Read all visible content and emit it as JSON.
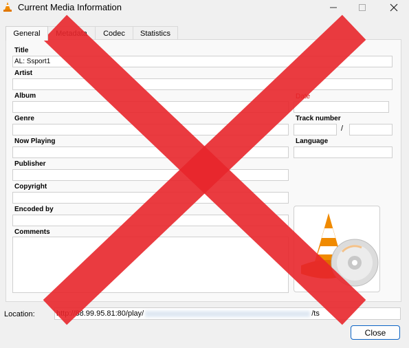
{
  "window": {
    "title": "Current Media Information",
    "icons": {
      "app": "vlc-cone-icon",
      "minimize": "minimize-icon",
      "maximize": "maximize-icon",
      "close": "close-icon"
    }
  },
  "tabs": [
    {
      "label": "General",
      "active": true
    },
    {
      "label": "Metadata",
      "active": false
    },
    {
      "label": "Codec",
      "active": false
    },
    {
      "label": "Statistics",
      "active": false
    }
  ],
  "general": {
    "title_label": "Title",
    "title_value": "AL: Ssport1",
    "artist_label": "Artist",
    "artist_value": "",
    "album_label": "Album",
    "album_value": "",
    "date_label": "Date",
    "date_value": "",
    "genre_label": "Genre",
    "genre_value": "",
    "track_number_label": "Track number",
    "track_number_value": "",
    "track_total_value": "",
    "track_separator": "/",
    "now_playing_label": "Now Playing",
    "now_playing_value": "",
    "language_label": "Language",
    "language_value": "",
    "publisher_label": "Publisher",
    "publisher_value": "",
    "copyright_label": "Copyright",
    "copyright_value": "",
    "encoded_by_label": "Encoded by",
    "encoded_by_value": "",
    "comments_label": "Comments",
    "comments_value": "",
    "artwork_icon": "vlc-cone-disc-icon"
  },
  "location": {
    "label": "Location:",
    "value_prefix": "http://88.99.95.81:80/play/",
    "value_suffix": "/ts"
  },
  "buttons": {
    "close": "Close"
  },
  "overlay": {
    "icon": "red-x-icon",
    "color": "#e8262b"
  },
  "colors": {
    "accent": "#0b63c5",
    "date_label": "#cc0000"
  }
}
